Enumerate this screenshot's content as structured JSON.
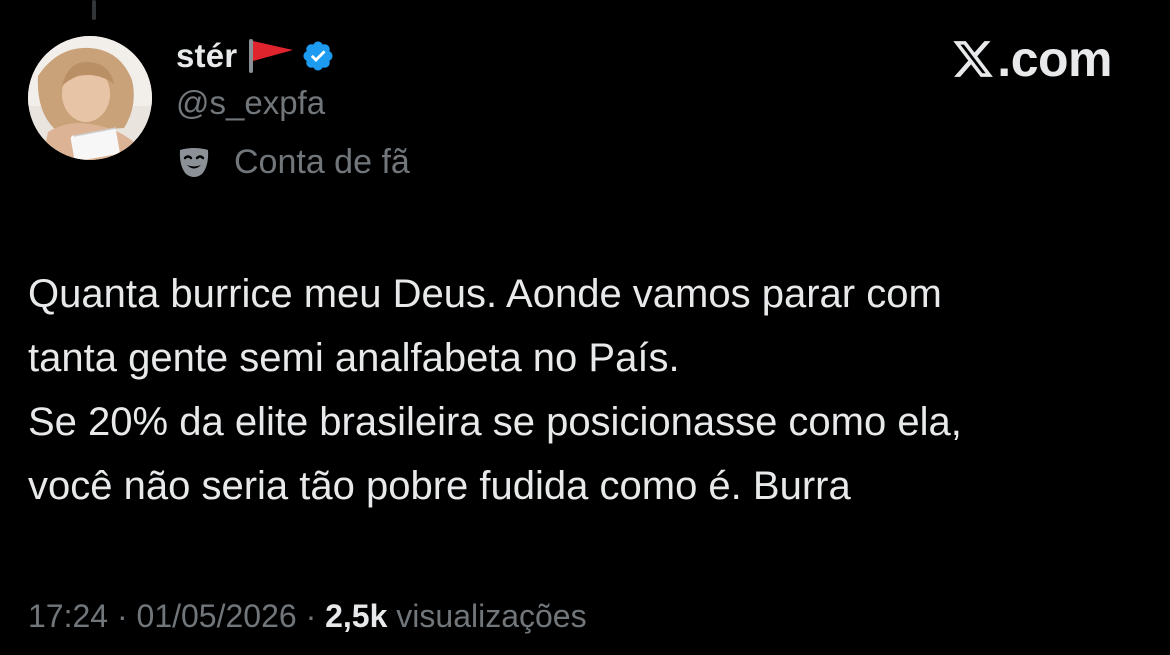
{
  "author": {
    "display_name": "stér",
    "flag_icon": "red-triangular-flag",
    "verified": true,
    "verified_color": "#1d9bf0",
    "handle": "@s_expfa",
    "account_label": "Conta de fã",
    "account_label_icon": "performing-arts-mask"
  },
  "brand": {
    "text": ".com",
    "logo": "x-logo"
  },
  "tweet": {
    "lines": [
      "Quanta burrice meu Deus. Aonde vamos parar com",
      "tanta gente semi analfabeta no País.",
      "Se 20% da elite brasileira se posicionasse como ela,",
      "você não seria tão pobre fudida como é. Burra"
    ]
  },
  "meta": {
    "time": "17:24",
    "separator": "·",
    "date": "01/05/2026",
    "views_count": "2,5k",
    "views_label": "visualizações"
  },
  "colors": {
    "background": "#000000",
    "primary_text": "#e7e9ea",
    "secondary_text": "#71767b",
    "accent": "#1d9bf0"
  }
}
